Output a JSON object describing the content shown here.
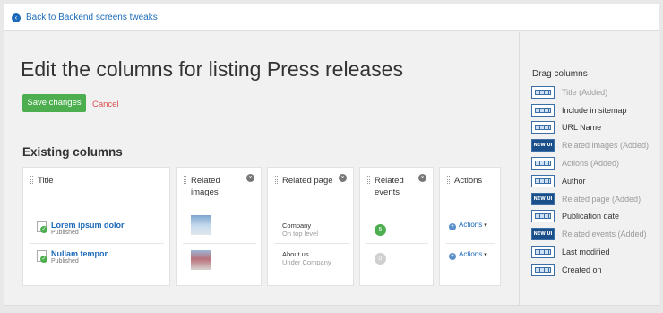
{
  "topbar": {
    "back_label": "Back to Backend screens tweaks"
  },
  "main": {
    "title": "Edit the columns for listing Press releases",
    "save_label": "Save changes",
    "cancel_label": "Cancel",
    "section_title": "Existing columns"
  },
  "columns": {
    "title": {
      "header": "Title",
      "items": [
        {
          "title": "Lorem ipsum dolor",
          "status": "Published"
        },
        {
          "title": "Nullam tempor",
          "status": "Published"
        }
      ]
    },
    "related_images": {
      "header": "Related images",
      "close": "×"
    },
    "related_page": {
      "header": "Related page",
      "close": "×",
      "rows": [
        {
          "name": "Company",
          "sub": "On top level"
        },
        {
          "name": "About us",
          "sub": "Under Company"
        }
      ]
    },
    "related_events": {
      "header": "Related events",
      "close": "×",
      "counts": [
        "5",
        "0"
      ]
    },
    "actions": {
      "header": "Actions",
      "link_label": "Actions",
      "caret": "▾"
    }
  },
  "sidebar": {
    "title": "Drag columns",
    "items": [
      {
        "label": "Title (Added)",
        "added": true,
        "icon": "column-icon"
      },
      {
        "label": "Include in sitemap",
        "added": false,
        "icon": "column-icon"
      },
      {
        "label": "URL Name",
        "added": false,
        "icon": "column-icon"
      },
      {
        "label": "Related images (Added)",
        "added": true,
        "icon": "new-ui-column-icon",
        "icon_text": "NEW UI"
      },
      {
        "label": "Actions (Added)",
        "added": true,
        "icon": "column-icon"
      },
      {
        "label": "Author",
        "added": false,
        "icon": "column-icon"
      },
      {
        "label": "Related page (Added)",
        "added": true,
        "icon": "new-ui-column-icon",
        "icon_text": "NEW UI"
      },
      {
        "label": "Publication date",
        "added": false,
        "icon": "column-icon"
      },
      {
        "label": "Related events (Added)",
        "added": true,
        "icon": "new-ui-column-icon",
        "icon_text": "NEW UI"
      },
      {
        "label": "Last modified",
        "added": false,
        "icon": "column-icon"
      },
      {
        "label": "Created on",
        "added": false,
        "icon": "column-icon"
      }
    ]
  },
  "colors": {
    "accent": "#1b6ab9",
    "save_button": "#4cae4f",
    "cancel": "#d9534f",
    "badge_green": "#4cae4f",
    "badge_grey": "#cfcfcf"
  }
}
